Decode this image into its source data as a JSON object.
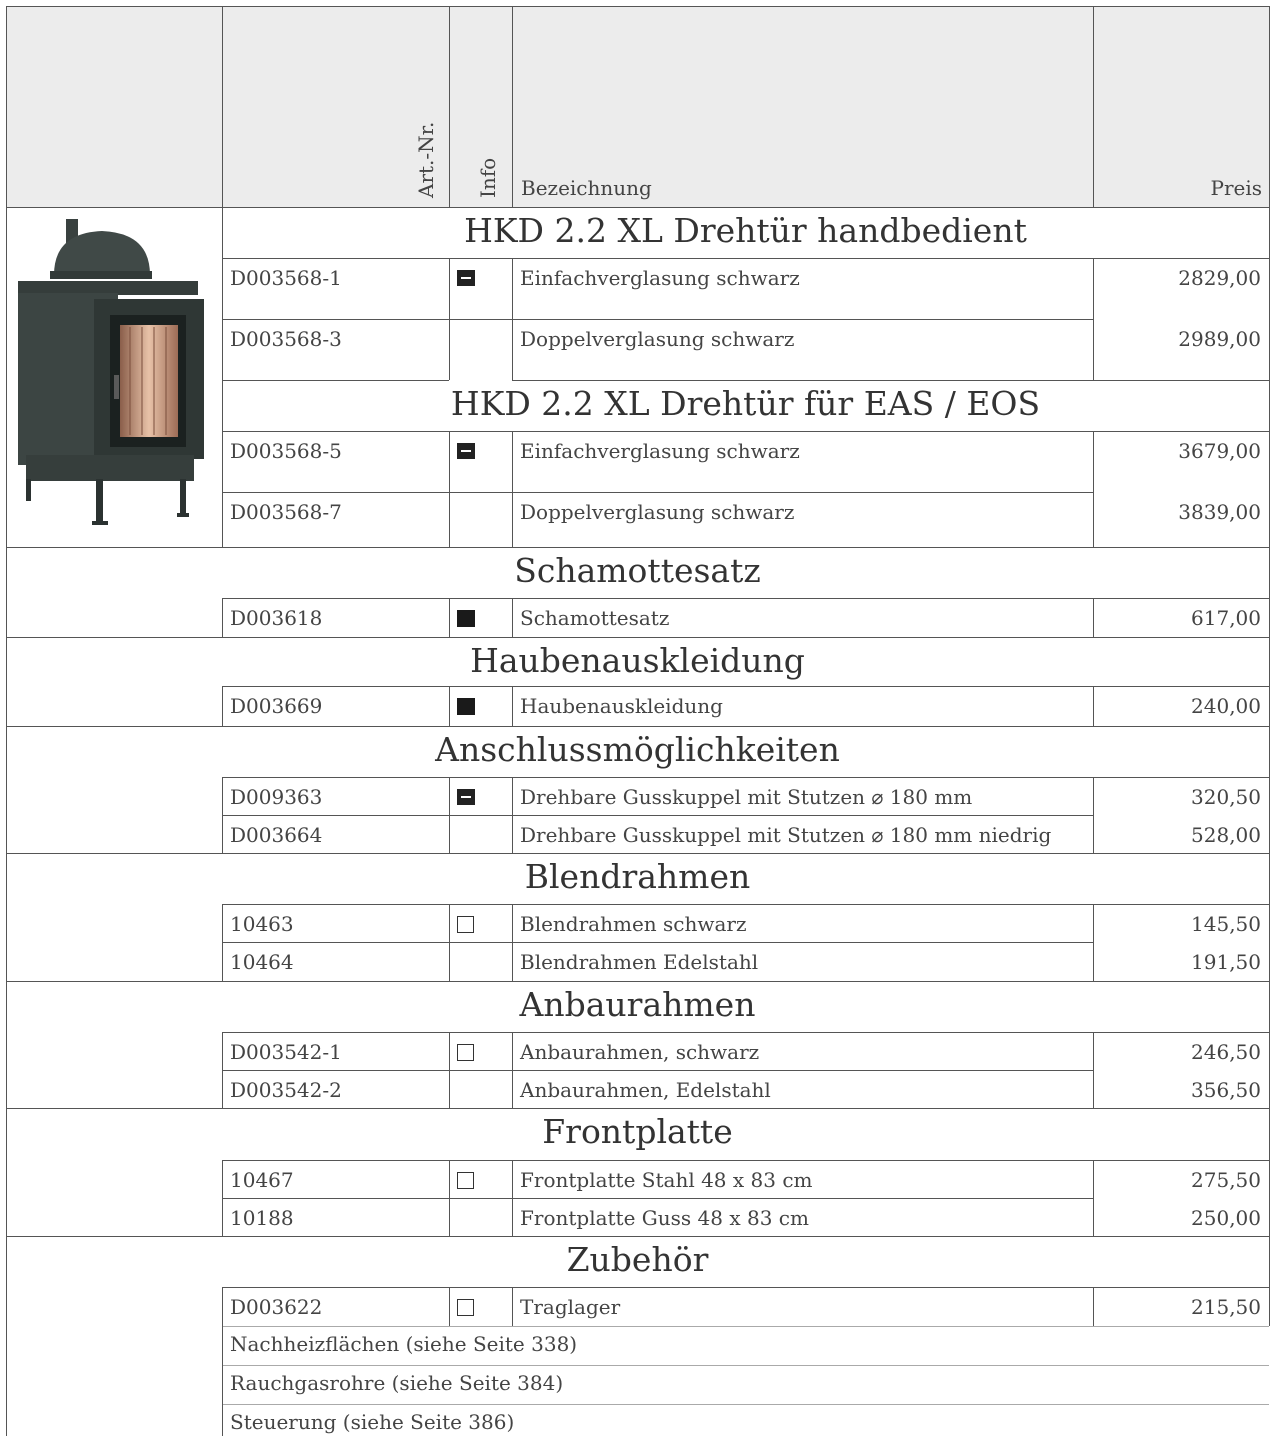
{
  "header": {
    "artnr_label": "Art.-Nr.",
    "info_label": "Info",
    "bezeichnung_label": "Bezeichnung",
    "preis_label": "Preis"
  },
  "sections": [
    {
      "title": "HKD 2.2 XL Drehtür handbedient",
      "rows": [
        {
          "artnr": "D003568-1",
          "icon": "minus-box-icon",
          "bez": "Einfachverglasung schwarz",
          "preis": "2829,00"
        },
        {
          "artnr": "D003568-3",
          "icon": "",
          "bez": "Doppelverglasung schwarz",
          "preis": "2989,00"
        }
      ]
    },
    {
      "title": "HKD 2.2 XL Drehtür für EAS / EOS",
      "rows": [
        {
          "artnr": "D003568-5",
          "icon": "minus-box-icon",
          "bez": "Einfachverglasung schwarz",
          "preis": "3679,00"
        },
        {
          "artnr": "D003568-7",
          "icon": "",
          "bez": "Doppelverglasung schwarz",
          "preis": "3839,00"
        }
      ]
    },
    {
      "title": "Schamottesatz",
      "rows": [
        {
          "artnr": "D003618",
          "icon": "filled-square-icon",
          "bez": "Schamottesatz",
          "preis": "617,00"
        }
      ]
    },
    {
      "title": "Haubenauskleidung",
      "rows": [
        {
          "artnr": "D003669",
          "icon": "filled-square-icon",
          "bez": "Haubenauskleidung",
          "preis": "240,00"
        }
      ]
    },
    {
      "title": "Anschlussmöglichkeiten",
      "rows": [
        {
          "artnr": "D009363",
          "icon": "minus-box-icon",
          "bez": "Drehbare Gusskuppel mit Stutzen ⌀ 180 mm",
          "preis": "320,50"
        },
        {
          "artnr": "D003664",
          "icon": "",
          "bez": "Drehbare Gusskuppel mit Stutzen ⌀ 180 mm niedrig",
          "preis": "528,00"
        }
      ]
    },
    {
      "title": "Blendrahmen",
      "rows": [
        {
          "artnr": "10463",
          "icon": "empty-square-icon",
          "bez": "Blendrahmen schwarz",
          "preis": "145,50"
        },
        {
          "artnr": "10464",
          "icon": "",
          "bez": "Blendrahmen Edelstahl",
          "preis": "191,50"
        }
      ]
    },
    {
      "title": "Anbaurahmen",
      "rows": [
        {
          "artnr": "D003542-1",
          "icon": "empty-square-icon",
          "bez": "Anbaurahmen, schwarz",
          "preis": "246,50"
        },
        {
          "artnr": "D003542-2",
          "icon": "",
          "bez": "Anbaurahmen, Edelstahl",
          "preis": "356,50"
        }
      ]
    },
    {
      "title": "Frontplatte",
      "rows": [
        {
          "artnr": "10467",
          "icon": "empty-square-icon",
          "bez": "Frontplatte Stahl 48 x 83 cm",
          "preis": "275,50"
        },
        {
          "artnr": "10188",
          "icon": "",
          "bez": "Frontplatte Guss 48 x 83 cm",
          "preis": "250,00"
        }
      ]
    },
    {
      "title": "Zubehör",
      "rows": [
        {
          "artnr": "D003622",
          "icon": "empty-square-icon",
          "bez": "Traglager",
          "preis": "215,50"
        }
      ]
    }
  ],
  "references": [
    "Nachheizflächen (siehe Seite 338)",
    "Rauchgasrohre (siehe Seite 384)",
    "Steuerung (siehe Seite 386)"
  ]
}
